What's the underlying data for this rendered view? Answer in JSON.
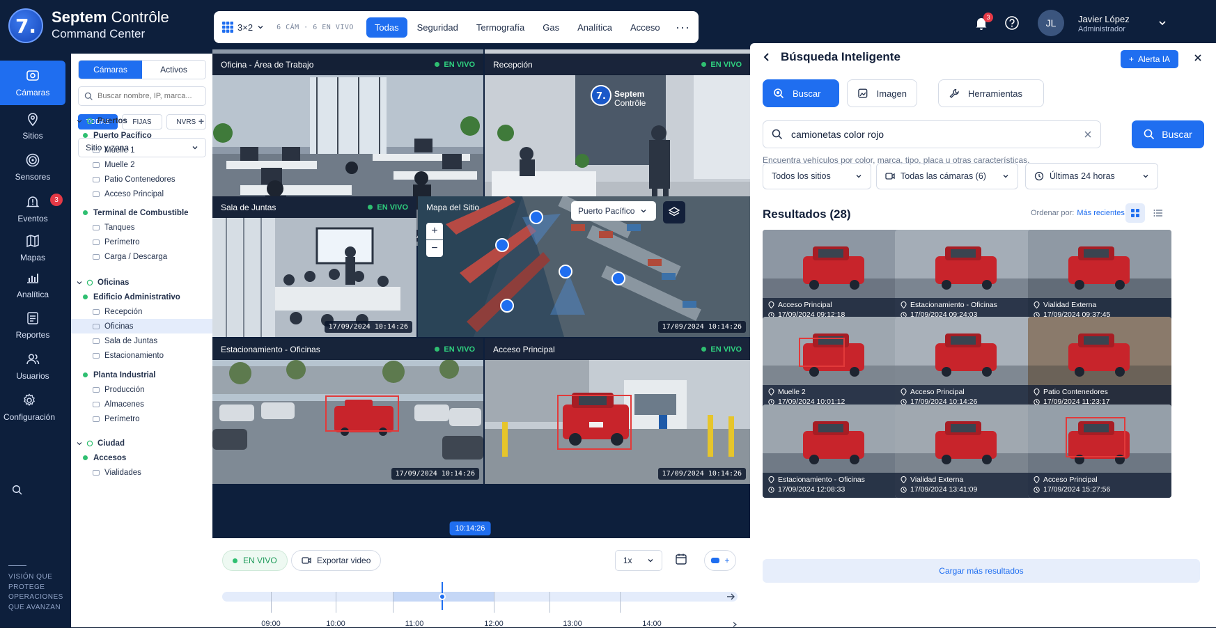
{
  "brand": {
    "mark": "7.",
    "name_bold": "Septem",
    "name_rest": " Contrôle",
    "subtitle": "Command Center"
  },
  "topnav": {
    "layout": "3×2",
    "cam_status": "6 CÁM · 6 EN VIVO",
    "tabs": [
      {
        "label": "Todas",
        "active": true
      },
      {
        "label": "Seguridad"
      },
      {
        "label": "Termografía"
      },
      {
        "label": "Gas"
      },
      {
        "label": "Analítica"
      },
      {
        "label": "Acceso"
      }
    ],
    "more": "···"
  },
  "user": {
    "notifications": "3",
    "initials": "JL",
    "name": "Javier López",
    "role": "Administrador"
  },
  "leftnav": {
    "items": [
      {
        "label": "Cámaras",
        "icon": "camera-icon",
        "active": true
      },
      {
        "label": "Sitios",
        "icon": "location-icon"
      },
      {
        "label": "Sensores",
        "icon": "sensor-icon"
      },
      {
        "label": "Eventos",
        "icon": "alert-icon",
        "badge": "3"
      },
      {
        "label": "Mapas",
        "icon": "map-icon"
      },
      {
        "label": "Analítica",
        "icon": "analytics-icon"
      },
      {
        "label": "Reportes",
        "icon": "report-icon"
      },
      {
        "label": "Usuarios",
        "icon": "users-icon"
      },
      {
        "label": "Configuración",
        "icon": "gear-icon"
      }
    ],
    "tagline": "VISIÓN QUE PROTEGE OPERACIONES QUE AVANZAN"
  },
  "campanel": {
    "seg": [
      "Cámaras",
      "Activos"
    ],
    "search_placeholder": "Buscar nombre, IP, marca...",
    "filters": [
      "TODAS",
      "FIJAS",
      "NVRS"
    ],
    "zone": "Sitio y zona",
    "tree": [
      {
        "label": "Puertos",
        "level": 0
      },
      {
        "label": "Puerto Pacífico",
        "level": 1
      },
      {
        "label": "Muelle 1",
        "level": 2
      },
      {
        "label": "Muelle 2",
        "level": 2
      },
      {
        "label": "Patio Contenedores",
        "level": 2
      },
      {
        "label": "Acceso Principal",
        "level": 2
      },
      {
        "label": "Terminal de Combustible",
        "level": 1
      },
      {
        "label": "Tanques",
        "level": 2
      },
      {
        "label": "Perímetro",
        "level": 2
      },
      {
        "label": "Carga / Descarga",
        "level": 2
      },
      {
        "label": "Oficinas",
        "level": 0
      },
      {
        "label": "Edificio Administrativo",
        "level": 1
      },
      {
        "label": "Recepción",
        "level": 2
      },
      {
        "label": "Oficinas",
        "level": 2,
        "selected": true
      },
      {
        "label": "Sala de Juntas",
        "level": 2
      },
      {
        "label": "Estacionamiento",
        "level": 2
      },
      {
        "label": "Planta Industrial",
        "level": 1
      },
      {
        "label": "Producción",
        "level": 2
      },
      {
        "label": "Almacenes",
        "level": 2
      },
      {
        "label": "Perímetro",
        "level": 2
      },
      {
        "label": "Ciudad",
        "level": 0
      },
      {
        "label": "Accesos",
        "level": 1
      },
      {
        "label": "Vialidades",
        "level": 2
      }
    ]
  },
  "tiles": {
    "live": "EN VIVO",
    "timestamp": "17/09/2024 10:14:26",
    "t1": "Oficina - Área de Trabajo",
    "t2": "Recepción",
    "t2_sign_a": "Septem",
    "t2_sign_b": "Contrôle",
    "t3": "Sala de Juntas",
    "t4": "Mapa del Sitio",
    "t4_site": "Puerto Pacífico",
    "t5": "Estacionamiento - Oficinas",
    "t6": "Acceso Principal"
  },
  "timeline": {
    "live": "EN VIVO",
    "export": "Exportar video",
    "speed": "1x",
    "now": "10:14:26",
    "hours": [
      "09:00",
      "10:00",
      "11:00",
      "12:00",
      "13:00",
      "14:00"
    ]
  },
  "search": {
    "title": "Búsqueda Inteligente",
    "alert_btn": "Alerta IA",
    "tabs": [
      "Buscar",
      "Imagen",
      "Herramientas"
    ],
    "query": "camionetas color rojo",
    "button": "Buscar",
    "hint": "Encuentra vehículos por color, marca, tipo, placa u otras características.",
    "filters": [
      "Todos los sitios",
      "Todas las cámaras (6)",
      "Últimas 24 horas"
    ],
    "results_title": "Resultados (28)",
    "sort_label": "Ordenar por:",
    "sort_value": "Más recientes",
    "results": [
      {
        "loc": "Acceso Principal",
        "time": "17/09/2024 09:12:18"
      },
      {
        "loc": "Estacionamiento - Oficinas",
        "time": "17/09/2024 09:24:03"
      },
      {
        "loc": "Vialidad Externa",
        "time": "17/09/2024 09:37:45"
      },
      {
        "loc": "Muelle 2",
        "time": "17/09/2024 10:01:12"
      },
      {
        "loc": "Acceso Principal",
        "time": "17/09/2024 10:14:26"
      },
      {
        "loc": "Patio Contenedores",
        "time": "17/09/2024 11:23:17"
      },
      {
        "loc": "Estacionamiento - Oficinas",
        "time": "17/09/2024 12:08:33"
      },
      {
        "loc": "Vialidad Externa",
        "time": "17/09/2024 13:41:09"
      },
      {
        "loc": "Acceso Principal",
        "time": "17/09/2024 15:27:56"
      }
    ],
    "load_more": "Cargar más resultados"
  }
}
